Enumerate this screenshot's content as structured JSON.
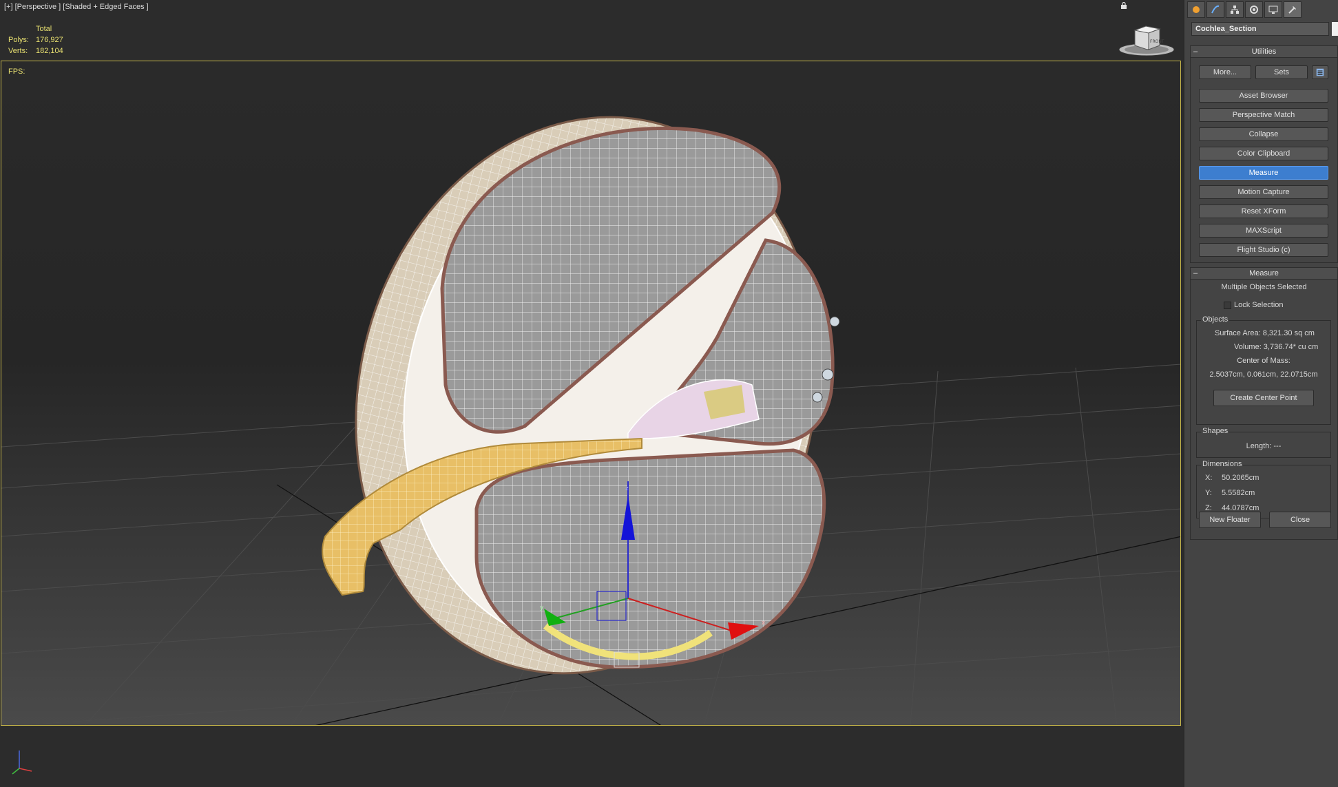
{
  "viewport": {
    "label": "[+] [Perspective ] [Shaded + Edged Faces ]",
    "stats": {
      "header": "Total",
      "polys_label": "Polys:",
      "polys_value": "176,927",
      "verts_label": "Verts:",
      "verts_value": "182,104"
    },
    "fps_label": "FPS:",
    "viewcube_face": "FRONT",
    "gizmo": {
      "z_label": "z",
      "x_label": "x",
      "y_label": "y"
    }
  },
  "panel": {
    "object_name": "Cochlea_Section",
    "tabs": [
      "create-icon",
      "modify-icon",
      "hierarchy-icon",
      "motion-icon",
      "display-icon",
      "utilities-icon"
    ],
    "utilities": {
      "title": "Utilities",
      "more_label": "More...",
      "sets_label": "Sets",
      "items": [
        "Asset Browser",
        "Perspective Match",
        "Collapse",
        "Color Clipboard",
        "Measure",
        "Motion Capture",
        "Reset XForm",
        "MAXScript",
        "Flight Studio (c)"
      ],
      "active_item": "Measure"
    },
    "measure": {
      "title": "Measure",
      "selection_text": "Multiple Objects Selected",
      "lock_selection_label": "Lock Selection",
      "objects_group": "Objects",
      "surface_area": "Surface Area:  8,321.30 sq cm",
      "volume": "Volume:  3,736.74* cu cm",
      "center_of_mass_label": "Center of Mass:",
      "center_of_mass_value": "2.5037cm, 0.061cm, 22.0715cm",
      "create_center_point": "Create Center Point",
      "shapes_group": "Shapes",
      "length": "Length:  ---",
      "dimensions_group": "Dimensions",
      "x_label": "X:",
      "x_value": "50.2065cm",
      "y_label": "Y:",
      "y_value": "5.5582cm",
      "z_label": "Z:",
      "z_value": "44.0787cm",
      "new_floater": "New Floater",
      "close": "Close"
    }
  },
  "colors": {
    "active_border": "#c8b84a",
    "stats_text": "#e8e070",
    "active_button": "#3d7ecf"
  }
}
